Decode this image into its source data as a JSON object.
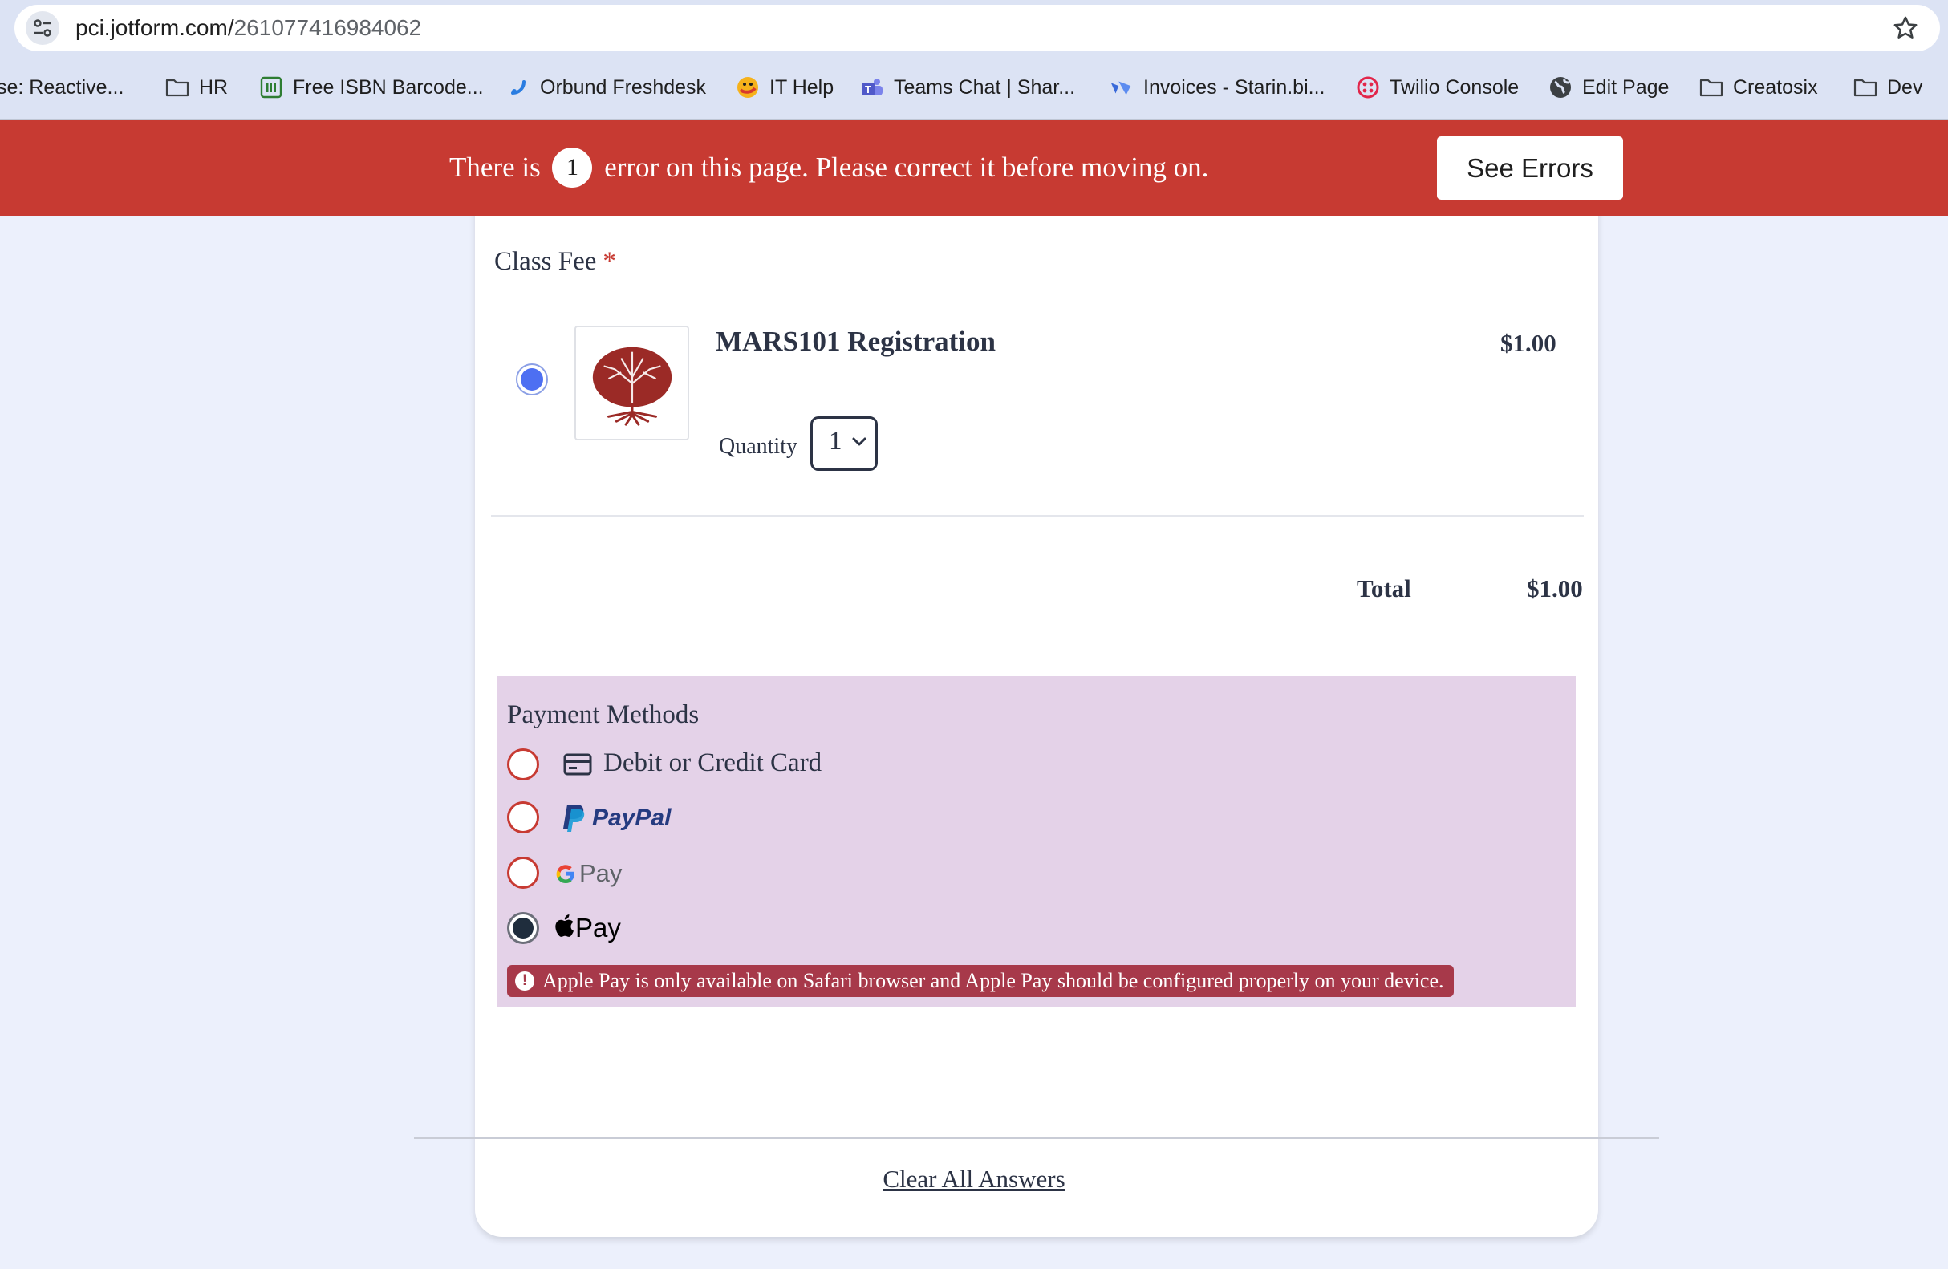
{
  "browser": {
    "url_host": "pci.jotform.com/",
    "url_path": "261077416984062",
    "bookmarks": [
      {
        "label": "se: Reactive...",
        "icon": "none"
      },
      {
        "label": "HR",
        "icon": "folder-icon"
      },
      {
        "label": "Free ISBN Barcode...",
        "icon": "barcode-icon"
      },
      {
        "label": "Orbund Freshdesk",
        "icon": "freshdesk-icon"
      },
      {
        "label": "IT Help",
        "icon": "it-help-icon"
      },
      {
        "label": "Teams Chat | Shar...",
        "icon": "teams-icon"
      },
      {
        "label": "Invoices - Starin.bi...",
        "icon": "invoices-icon"
      },
      {
        "label": "Twilio Console",
        "icon": "twilio-icon"
      },
      {
        "label": "Edit Page",
        "icon": "globe-icon"
      },
      {
        "label": "Creatosix",
        "icon": "folder-icon"
      },
      {
        "label": "Dev",
        "icon": "folder-icon"
      }
    ]
  },
  "error_banner": {
    "prefix": "There is",
    "count": "1",
    "suffix": "error on this page. Please correct it before moving on.",
    "button": "See Errors"
  },
  "form": {
    "class_fee_label": "Class Fee",
    "required_mark": "*",
    "product": {
      "name": "MARS101 Registration",
      "price": "$1.00",
      "quantity_label": "Quantity",
      "quantity_value": "1",
      "selected": true
    },
    "total_label": "Total",
    "total_value": "$1.00",
    "payment_methods": {
      "title": "Payment Methods",
      "options": [
        {
          "label": "Debit or Credit Card",
          "checked": false
        },
        {
          "label": "PayPal",
          "checked": false
        },
        {
          "label": "Pay",
          "checked": false
        },
        {
          "label": "Pay",
          "checked": true
        }
      ],
      "error": "Apple Pay is only available on Safari browser and Apple Pay should be configured properly on your device."
    },
    "clear_all": "Clear All Answers"
  },
  "colors": {
    "error_red": "#c73a32",
    "selected_blue": "#4d6ff2",
    "payment_bg": "#e4d2e8",
    "error_pill": "#a7394a"
  }
}
